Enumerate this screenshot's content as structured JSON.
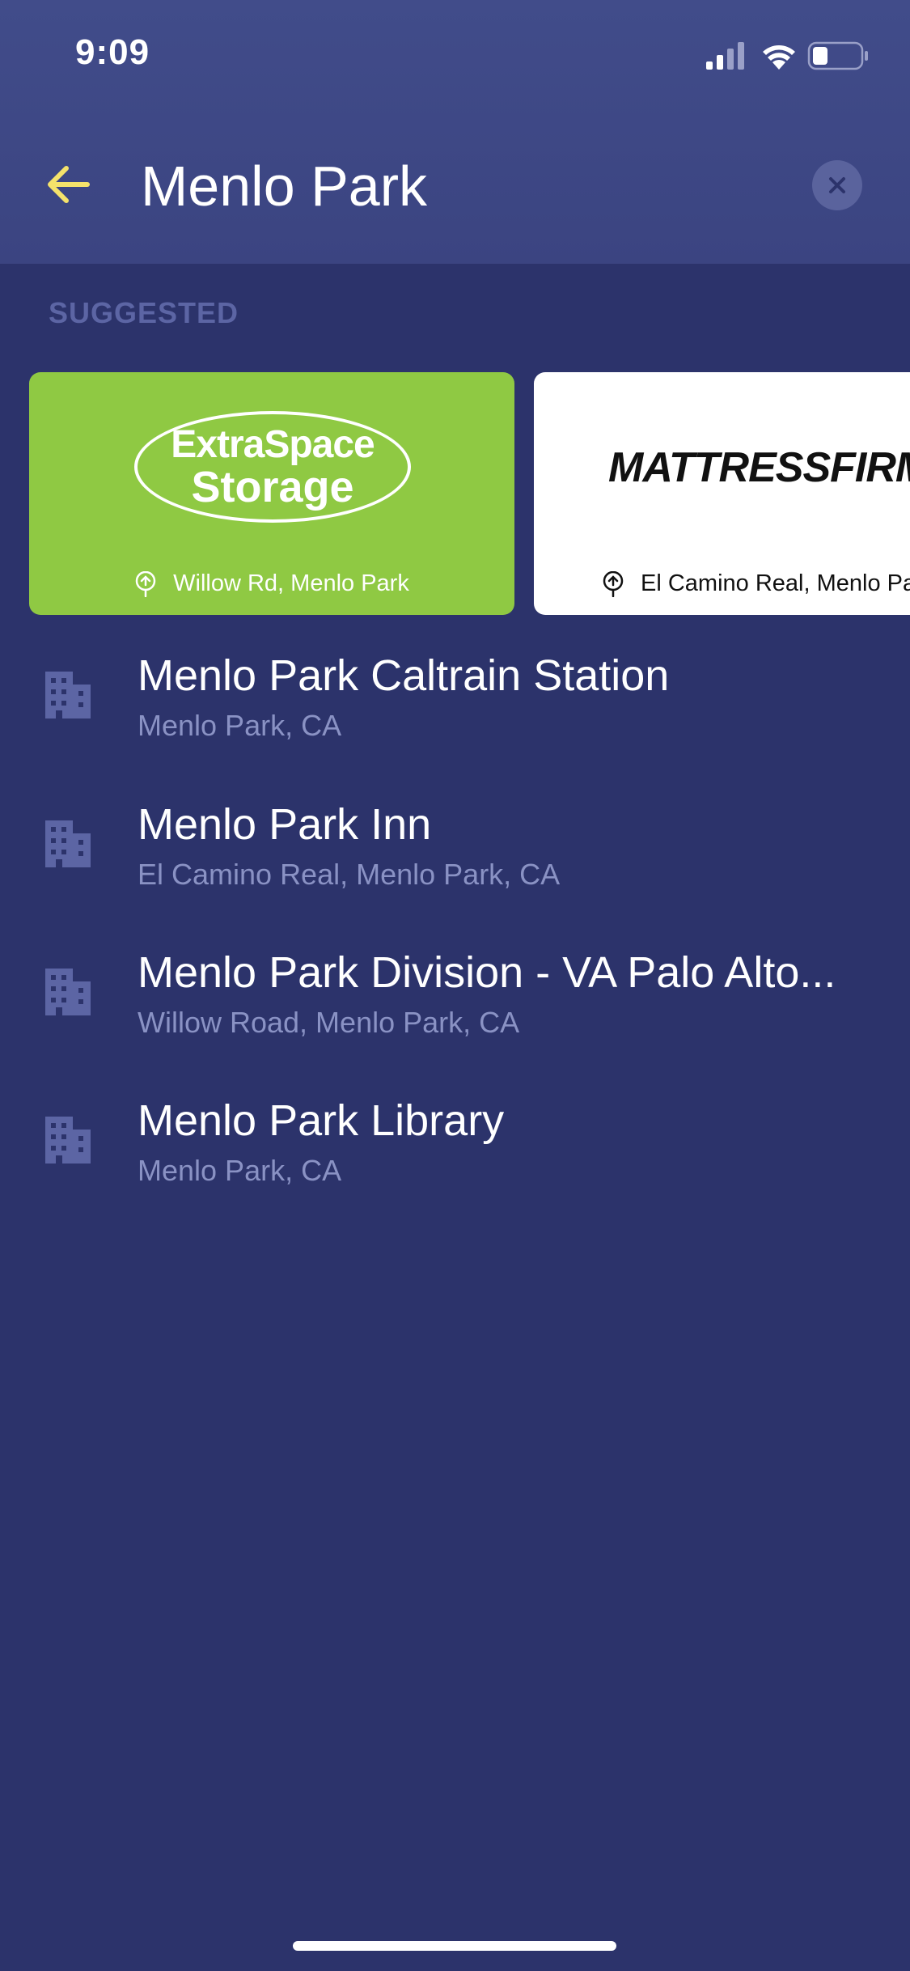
{
  "status_bar": {
    "time": "9:09"
  },
  "search": {
    "value": "Menlo Park"
  },
  "suggested": {
    "title": "SUGGESTED",
    "cards": [
      {
        "brand_line1": "ExtraSpace",
        "brand_line2": "Storage",
        "location": "Willow Rd, Menlo Park",
        "color": "#8fc943"
      },
      {
        "brand": "MATTRESSFIRM",
        "location": "El Camino Real, Menlo Park",
        "color": "#ffffff"
      }
    ]
  },
  "results": [
    {
      "title": "Menlo Park Caltrain Station",
      "subtitle": "Menlo Park, CA",
      "icon": "building-icon"
    },
    {
      "title": "Menlo Park Inn",
      "subtitle": "El Camino Real, Menlo Park, CA",
      "icon": "building-icon"
    },
    {
      "title": "Menlo Park Division - VA Palo Alto...",
      "subtitle": "Willow Road, Menlo Park, CA",
      "icon": "building-icon"
    },
    {
      "title": "Menlo Park Library",
      "subtitle": "Menlo Park, CA",
      "icon": "building-icon"
    }
  ],
  "colors": {
    "background": "#2c336b",
    "header": "#3d4684",
    "accent": "#f5e26b",
    "subtitle": "#8a92c4",
    "icon": "#5c65a4"
  }
}
